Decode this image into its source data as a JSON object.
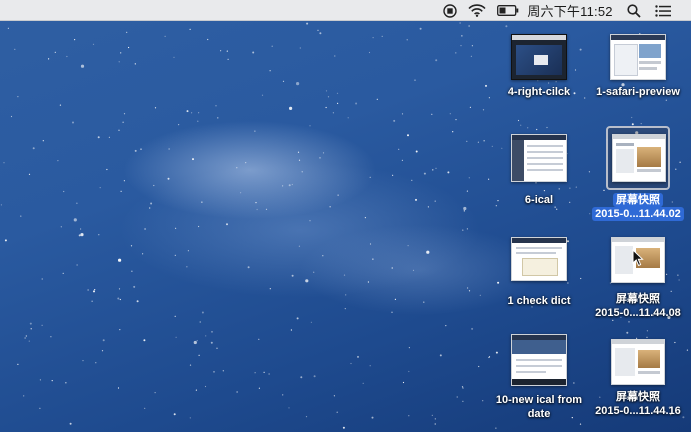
{
  "menubar": {
    "clock": "周六下午11:52",
    "icons": [
      "record-stop-icon",
      "wifi-icon",
      "battery-icon",
      "spotlight-search-icon",
      "notification-center-icon"
    ]
  },
  "desktop": {
    "items": [
      {
        "name": "4-right-cilck",
        "line1": "4-right-cilck",
        "line2": ""
      },
      {
        "name": "1-safari-preview",
        "line1": "1-safari-preview",
        "line2": ""
      },
      {
        "name": "6-ical",
        "line1": "6-ical",
        "line2": ""
      },
      {
        "name": "screenshot-11-44-02",
        "line1": "屏幕快照",
        "line2": "2015-0...11.44.02"
      },
      {
        "name": "1-check-dict",
        "line1": "1 check dict",
        "line2": ""
      },
      {
        "name": "screenshot-11-44-08",
        "line1": "屏幕快照",
        "line2": "2015-0...11.44.08"
      },
      {
        "name": "10-new-ical-from-date",
        "line1": "10-new ical from",
        "line2": "date"
      },
      {
        "name": "screenshot-11-44-16",
        "line1": "屏幕快照",
        "line2": "2015-0...11.44.16"
      }
    ]
  },
  "colors": {
    "menubar": "#e9eaec",
    "desktop_blue": "#2a5aa0",
    "selection": "#2f6ad6"
  }
}
